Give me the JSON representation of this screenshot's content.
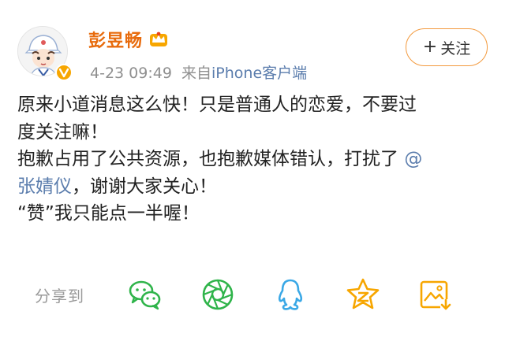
{
  "post": {
    "username": "彭昱畅",
    "timestamp": "4-23 09:49",
    "source_prefix": "来自",
    "source": "iPhone客户端",
    "follow_label": "关注",
    "content": {
      "line1": "原来小道消息这么快！只是普通人的恋爱，不要过",
      "line2": "度关注嘛！",
      "line3_text": "抱歉占用了公共资源，也抱歉媒体错认，打扰了",
      "line3_mention": "@",
      "line4_mention": "张婧仪",
      "line4_text": "，谢谢大家关心！",
      "line5": "“赞”我只能点一半喔！"
    }
  },
  "share": {
    "label": "分享到",
    "targets": [
      "wechat-icon",
      "moments-icon",
      "qq-icon",
      "qzone-icon",
      "save-image-icon"
    ]
  },
  "colors": {
    "username": "#e86b0c",
    "link": "#5b7dad",
    "meta": "#8f8f8f",
    "follow_border": "#f39a3e",
    "icon_green": "#2fb44a",
    "icon_blue": "#3aa8e6",
    "icon_orange": "#f7a600",
    "badge": "#f7a600"
  }
}
